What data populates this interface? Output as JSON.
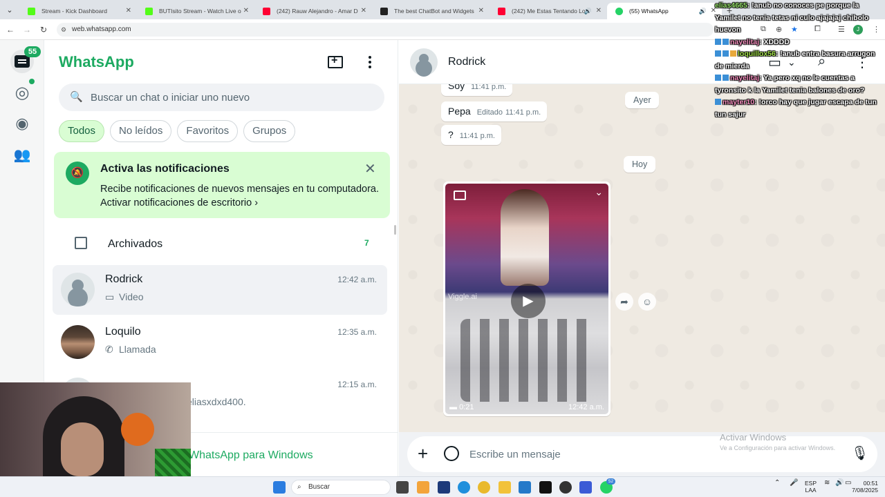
{
  "browser": {
    "tabs": [
      {
        "title": "Stream - Kick Dashboard",
        "color": "#53fc18"
      },
      {
        "title": "BUTIsito Stream - Watch Live o",
        "color": "#53fc18"
      },
      {
        "title": "(242) Rauw Alejandro - Amar D",
        "color": "#ff0033"
      },
      {
        "title": "The best ChatBot and Widgets",
        "color": "#222222"
      },
      {
        "title": "(242) Me Estas Tentando Lo",
        "color": "#ff0033"
      },
      {
        "title": "(55) WhatsApp",
        "color": "#25d366"
      }
    ],
    "url": "web.whatsapp.com",
    "profile_initial": "J"
  },
  "whatsapp": {
    "brand": "WhatsApp",
    "unread_badge": "55",
    "search_placeholder": "Buscar un chat o iniciar uno nuevo",
    "filters": [
      "Todos",
      "No leídos",
      "Favoritos",
      "Grupos"
    ],
    "notification": {
      "title": "Activa las notificaciones",
      "desc": "Recibe notificaciones de nuevos mensajes en tu computadora.",
      "link": "Activar notificaciones de escritorio"
    },
    "archived": {
      "label": "Archivados",
      "count": "7"
    },
    "chats": [
      {
        "name": "Rodrick",
        "time": "12:42 a.m.",
        "preview": "Video",
        "icon": "video-icon"
      },
      {
        "name": "Loquilo",
        "time": "12:35 a.m.",
        "preview": "Llamada",
        "icon": "phone-icon"
      },
      {
        "name": "",
        "time": "12:15 a.m.",
        "preview": "eliasxdxd400."
      }
    ],
    "promo_link": "WhatsApp para Windows"
  },
  "conversation": {
    "contact": "Rodrick",
    "messages": [
      {
        "text": "Soy",
        "time": "11:41 p.m."
      },
      {
        "text": "Pepa",
        "edited": "Editado",
        "time": "11:41 p.m."
      },
      {
        "text": "?",
        "time": "11:41 p.m."
      }
    ],
    "date_ayer": "Ayer",
    "date_hoy": "Hoy",
    "video": {
      "watermark": "Viggle.ai",
      "duration": "0:21",
      "time": "12:42 a.m."
    },
    "composer_placeholder": "Escribe un mensaje"
  },
  "windows_watermark": {
    "line1": "Activar Windows",
    "line2": "Ve a Configuración para activar Windows."
  },
  "stream_chat": [
    {
      "user": "elias4665",
      "msg": ": !anub no conoces pe porque la Yamilet no tenia tetas ni culo ajajajaj chibolo huevon"
    },
    {
      "user": "nayelitaj",
      "msg": ": XDDDD"
    },
    {
      "user": "loquillox56",
      "msg": ": !anub entra basura arrugon de mierda"
    },
    {
      "user": "nayelitaj",
      "msg": ": Ya pero xq no le cuentas a tyronsito k la Yamilet tenia balones de oro?"
    },
    {
      "user": "mayter10",
      "msg": ": !orco hay que jugar escapa de tun tun sajur"
    }
  ],
  "taskbar": {
    "search": "Buscar",
    "lang1": "ESP",
    "lang2": "LAA",
    "time": "00:51",
    "date": "7/08/2025",
    "badge": "52"
  }
}
